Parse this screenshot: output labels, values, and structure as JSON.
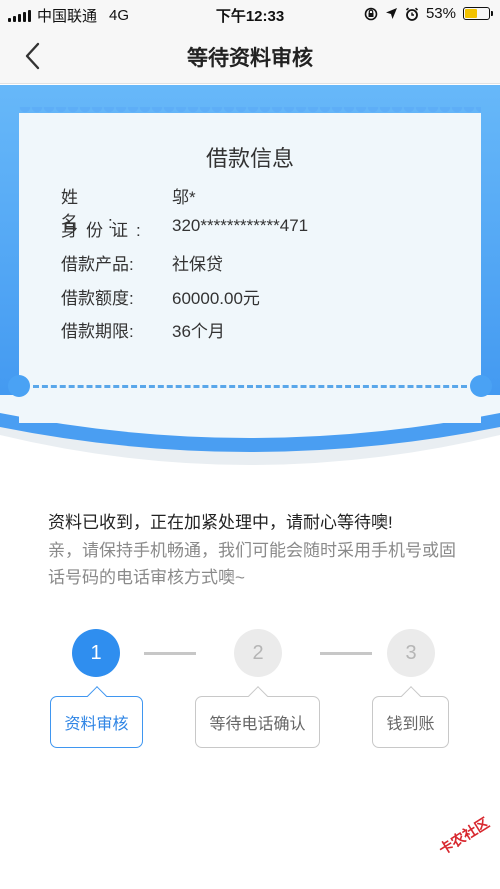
{
  "status_bar": {
    "carrier": "中国联通",
    "network": "4G",
    "time": "下午12:33",
    "battery_percent": "53%",
    "battery_level": 0.53
  },
  "nav": {
    "title": "等待资料审核",
    "back_icon": "chevron-left-icon"
  },
  "ticket": {
    "title": "借款信息",
    "rows": [
      {
        "label": "姓名:",
        "value": "邬*"
      },
      {
        "label": "身份证:",
        "value": "320************471"
      },
      {
        "label": "借款产品:",
        "value": "社保贷"
      },
      {
        "label": "借款额度:",
        "value": "60000.00元"
      },
      {
        "label": "借款期限:",
        "value": "36个月"
      }
    ]
  },
  "message": {
    "main": "资料已收到，正在加紧处理中，请耐心等待噢!",
    "sub": "亲，请保持手机畅通，我们可能会随时采用手机号或固话号码的电话审核方式噢~"
  },
  "steps": [
    {
      "number": "1",
      "label": "资料审核",
      "active": true
    },
    {
      "number": "2",
      "label": "等待电话确认",
      "active": false
    },
    {
      "number": "3",
      "label": "钱到账",
      "active": false
    }
  ],
  "watermark": "卡农社区",
  "colors": {
    "accent": "#2f8eef",
    "header_gradient_top": "#67b8f9",
    "header_gradient_bottom": "#3f96f0",
    "ticket_bg": "#f0f7fb"
  }
}
